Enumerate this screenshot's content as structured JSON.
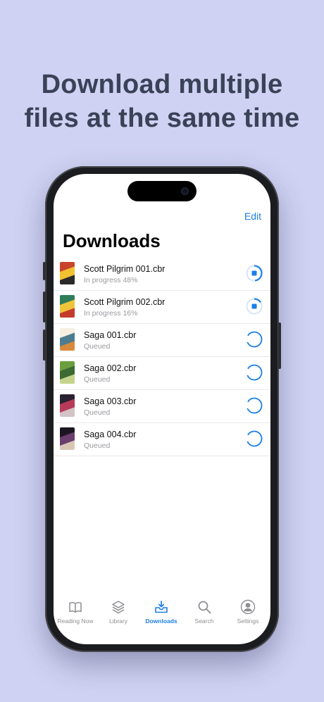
{
  "headline": {
    "line1": "Download multiple",
    "line2": "files at the same time"
  },
  "nav": {
    "edit_label": "Edit",
    "title": "Downloads"
  },
  "downloads": [
    {
      "name": "Scott Pilgrim 001.cbr",
      "status": "In progress 48%",
      "progress": 0.48,
      "cover_colors": [
        "#c8452a",
        "#f2c230",
        "#2a2a2a"
      ]
    },
    {
      "name": "Scott Pilgrim 002.cbr",
      "status": "In progress 16%",
      "progress": 0.16,
      "cover_colors": [
        "#2e7c5a",
        "#f0c43a",
        "#c43b2d"
      ]
    },
    {
      "name": "Saga 001.cbr",
      "status": "Queued",
      "progress": 0,
      "cover_colors": [
        "#f5efe1",
        "#4c7c8f",
        "#d78a3c"
      ]
    },
    {
      "name": "Saga 002.cbr",
      "status": "Queued",
      "progress": 0,
      "cover_colors": [
        "#6c9e3e",
        "#3c6a31",
        "#c5d48c"
      ]
    },
    {
      "name": "Saga 003.cbr",
      "status": "Queued",
      "progress": 0,
      "cover_colors": [
        "#2a2230",
        "#b83a5a",
        "#d4c3c6"
      ]
    },
    {
      "name": "Saga 004.cbr",
      "status": "Queued",
      "progress": 0,
      "cover_colors": [
        "#1c1620",
        "#6a3e6e",
        "#d9c7b6"
      ]
    }
  ],
  "tabs": [
    {
      "label": "Reading Now",
      "icon": "book-icon",
      "active": false
    },
    {
      "label": "Library",
      "icon": "stack-icon",
      "active": false
    },
    {
      "label": "Downloads",
      "icon": "tray-download-icon",
      "active": true
    },
    {
      "label": "Search",
      "icon": "search-icon",
      "active": false
    },
    {
      "label": "Settings",
      "icon": "profile-icon",
      "active": false
    }
  ],
  "colors": {
    "accent": "#1a7fe6",
    "background": "#cfd2f3",
    "headline": "#3a4257"
  }
}
